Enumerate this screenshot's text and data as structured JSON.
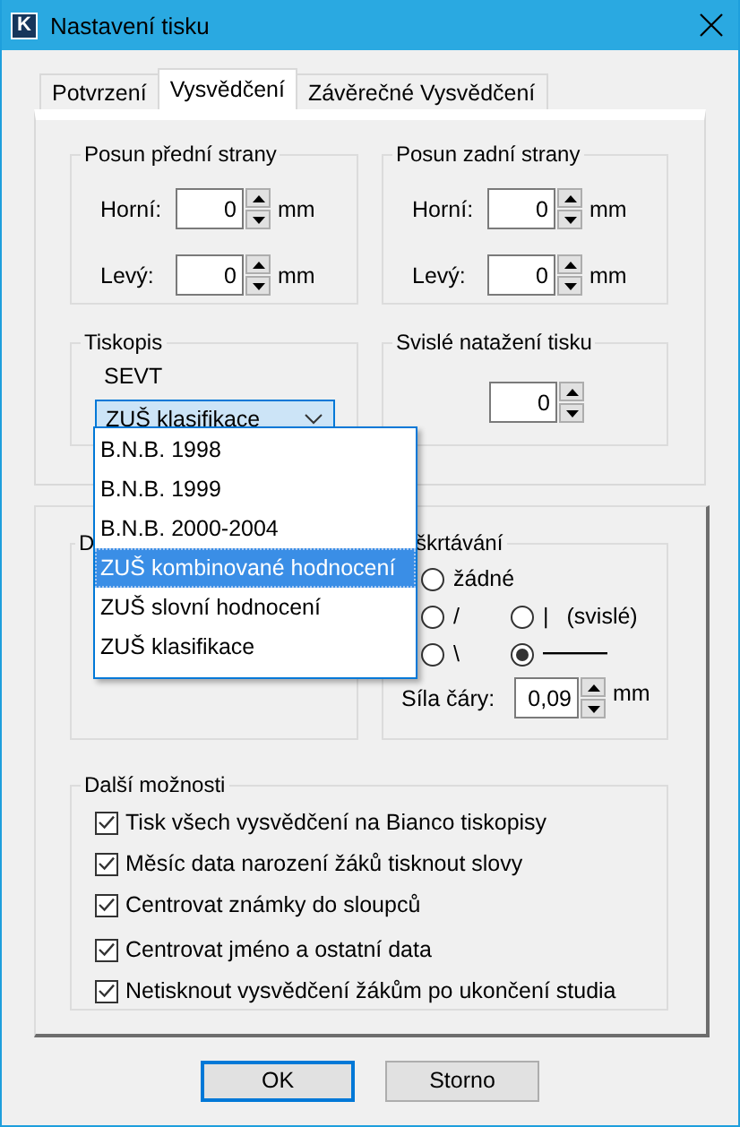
{
  "window": {
    "icon_letter": "K",
    "title": "Nastavení tisku"
  },
  "tabs": [
    {
      "label": "Potvrzení",
      "selected": false
    },
    {
      "label": "Vysvědčení",
      "selected": true
    },
    {
      "label": "Závěrečné Vysvědčení",
      "selected": false
    }
  ],
  "front_offset": {
    "title": "Posun přední strany",
    "fields": [
      {
        "label": "Horní:",
        "value": "0",
        "unit": "mm"
      },
      {
        "label": "Levý:",
        "value": "0",
        "unit": "mm"
      }
    ]
  },
  "back_offset": {
    "title": "Posun zadní strany",
    "fields": [
      {
        "label": "Horní:",
        "value": "0",
        "unit": "mm"
      },
      {
        "label": "Levý:",
        "value": "0",
        "unit": "mm"
      }
    ]
  },
  "form": {
    "title": "Tiskopis",
    "subtitle": "SEVT",
    "combo": {
      "value": "ZUŠ klasifikace",
      "expanded": true,
      "options": [
        {
          "label": "B.N.B. 1998",
          "highlighted": false
        },
        {
          "label": "B.N.B. 1999",
          "highlighted": false
        },
        {
          "label": "B.N.B. 2000-2004",
          "highlighted": false
        },
        {
          "label": "ZUŠ kombinované hodnocení",
          "highlighted": true
        },
        {
          "label": "ZUŠ slovní hodnocení",
          "highlighted": false
        },
        {
          "label": "ZUŠ klasifikace",
          "highlighted": false
        }
      ]
    }
  },
  "vertical": {
    "title": "Svislé natažení tisku",
    "value": "0"
  },
  "group_d": {
    "title": "D"
  },
  "strike": {
    "title": "škrtávání",
    "options": [
      {
        "kind": "text",
        "label": "žádné",
        "selected": false
      },
      {
        "kind": "text",
        "label": "/",
        "selected": false
      },
      {
        "kind": "text",
        "label": "|",
        "note": "(svislé)",
        "selected": false
      },
      {
        "kind": "text",
        "label": "\\",
        "selected": false
      },
      {
        "kind": "line",
        "selected": true
      }
    ],
    "line_width": {
      "label": "Síla čáry:",
      "value": "0,09",
      "unit": "mm"
    }
  },
  "more": {
    "title": "Další možnosti",
    "checkboxes": [
      {
        "label": "Tisk všech vysvědčení na Bianco tiskopisy",
        "checked": true
      },
      {
        "label": "Měsíc data narození žáků tisknout slovy",
        "checked": true
      },
      {
        "label": "Centrovat známky do sloupců",
        "checked": true
      },
      {
        "label": "Centrovat jméno a ostatní data",
        "checked": true
      },
      {
        "label": "Netisknout vysvědčení žákům po ukončení studia",
        "checked": true
      }
    ]
  },
  "buttons": [
    {
      "label": "OK",
      "default": true
    },
    {
      "label": "Storno",
      "default": false
    }
  ]
}
